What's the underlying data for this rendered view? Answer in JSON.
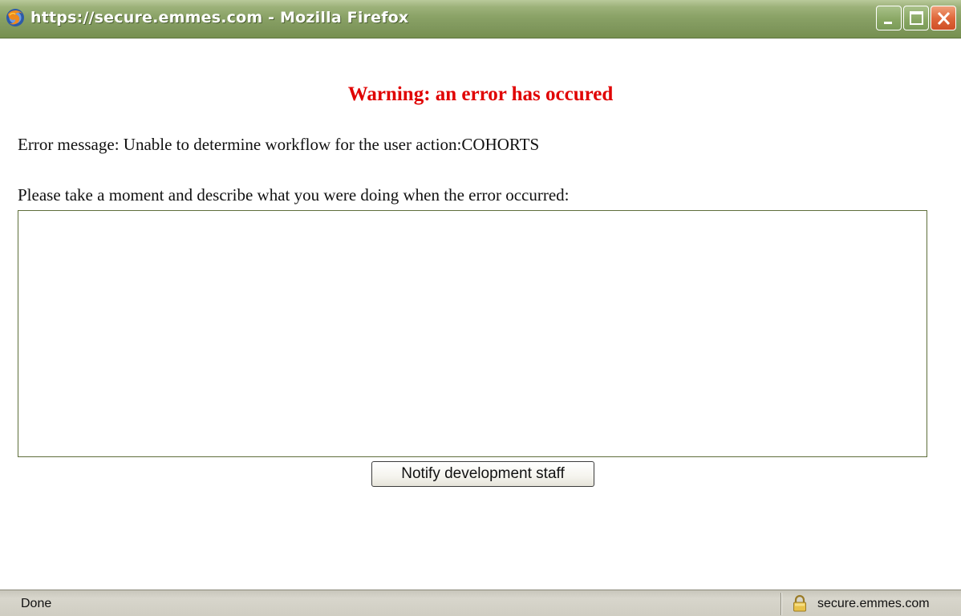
{
  "window": {
    "title": "https://secure.emmes.com - Mozilla Firefox",
    "app_icon": "firefox-icon",
    "controls": {
      "minimize": "minimize-icon",
      "maximize": "maximize-icon",
      "close": "close-icon"
    },
    "colors": {
      "titlebar": "#8aa266",
      "close_button": "#e0683c"
    }
  },
  "page": {
    "warning_title": "Warning: an error has occured",
    "error_message": "Error message: Unable to determine workflow for the user action:COHORTS",
    "prompt": "Please take a moment and describe what you were doing when the error occurred:",
    "description_value": "",
    "notify_button_label": "Notify development staff",
    "colors": {
      "warning": "#e00000"
    }
  },
  "statusbar": {
    "status": "Done",
    "security_icon": "lock-icon",
    "domain": "secure.emmes.com"
  }
}
